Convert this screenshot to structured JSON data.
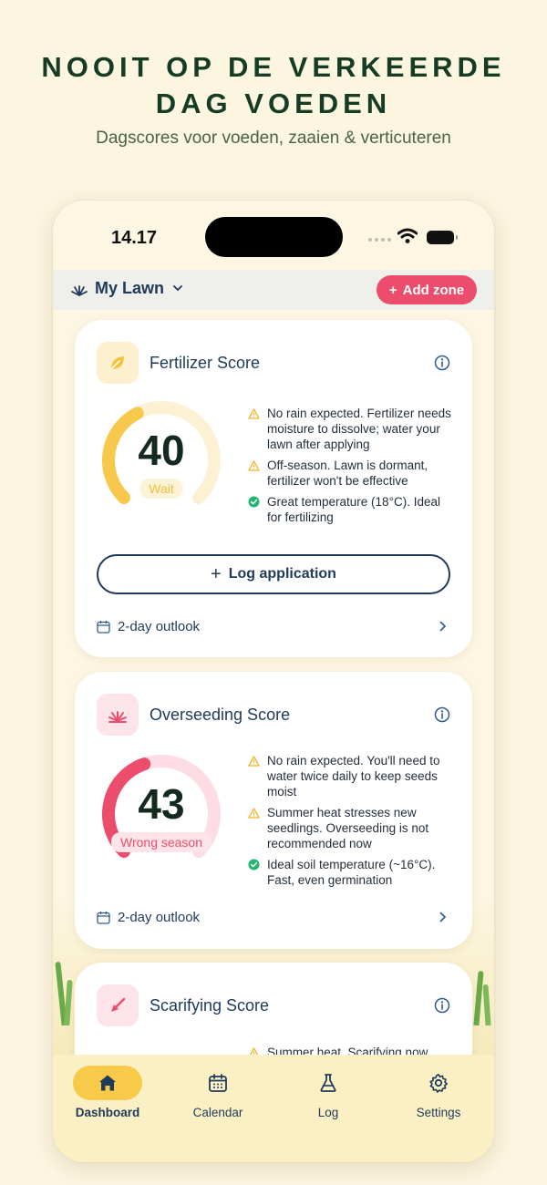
{
  "promo": {
    "headline_line1": "NOOIT OP DE VERKEERDE",
    "headline_line2": "DAG VOEDEN",
    "subheadline": "Dagscores voor voeden, zaaien & verticuteren"
  },
  "status_bar": {
    "time": "14.17"
  },
  "zone_bar": {
    "zone_name": "My Lawn",
    "add_zone_label": "Add zone"
  },
  "cards": [
    {
      "title": "Fertilizer Score",
      "score": "40",
      "score_fraction": 0.4,
      "status_label": "Wait",
      "accent_color": "#f8c84c",
      "messages": [
        {
          "type": "warning",
          "text": "No rain expected. Fertilizer needs moisture to dissolve; water your lawn after applying"
        },
        {
          "type": "warning",
          "text": "Off-season. Lawn is dormant, fertilizer won't be effective"
        },
        {
          "type": "ok",
          "text": "Great temperature (18°C). Ideal for fertilizing"
        }
      ],
      "action_label": "Log application",
      "outlook_label": "2-day outlook"
    },
    {
      "title": "Overseeding Score",
      "score": "43",
      "score_fraction": 0.43,
      "status_label": "Wrong season",
      "accent_color": "#ec4d6c",
      "messages": [
        {
          "type": "warning",
          "text": "No rain expected. You'll need to water twice daily to keep seeds moist"
        },
        {
          "type": "warning",
          "text": "Summer heat stresses new seedlings. Overseeding is not recommended now"
        },
        {
          "type": "ok",
          "text": "Ideal soil temperature (~16°C). Fast, even germination"
        }
      ],
      "outlook_label": "2-day outlook"
    },
    {
      "title": "Scarifying Score",
      "accent_color": "#ec4d6c",
      "messages": [
        {
          "type": "warning",
          "text": "Summer heat. Scarifying now"
        }
      ]
    }
  ],
  "tabs": [
    {
      "label": "Dashboard",
      "icon": "home-icon",
      "active": true
    },
    {
      "label": "Calendar",
      "icon": "calendar-icon",
      "active": false
    },
    {
      "label": "Log",
      "icon": "flask-icon",
      "active": false
    },
    {
      "label": "Settings",
      "icon": "gear-icon",
      "active": false
    }
  ],
  "colors": {
    "background": "#fcf5e0",
    "headline": "#173c24",
    "navy": "#1f3a5a",
    "accent_pink": "#ec4d6c",
    "accent_yellow": "#f8c84c",
    "ok_green": "#22b573",
    "warn_yellow": "#f2b42a"
  }
}
